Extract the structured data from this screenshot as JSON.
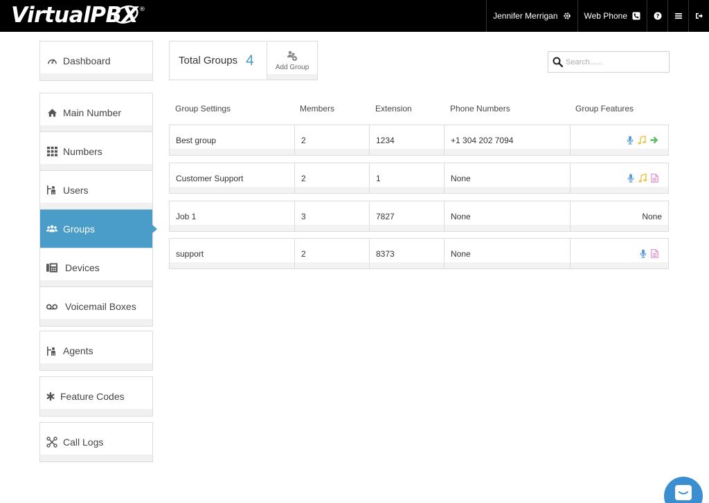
{
  "app": {
    "logo_text_virtual": "Virtual",
    "logo_text_pbx": "PBX",
    "logo_reg": "®"
  },
  "header": {
    "user_name": "Jennifer Merrigan",
    "web_phone_label": "Web Phone",
    "icons": [
      "gear-icon",
      "phone-icon",
      "help-icon",
      "menu-icon",
      "logout-icon"
    ]
  },
  "sidebar": {
    "groups": [
      {
        "items": [
          {
            "label": "Dashboard",
            "icon": "dashboard-icon",
            "active": false
          }
        ]
      },
      {
        "items": [
          {
            "label": "Main Number",
            "icon": "home-icon",
            "active": false
          },
          {
            "label": "Numbers",
            "icon": "grid-icon",
            "active": false
          },
          {
            "label": "Users",
            "icon": "users-icon",
            "active": false
          },
          {
            "label": "Groups",
            "icon": "group-icon",
            "active": true
          },
          {
            "label": "Devices",
            "icon": "fax-icon",
            "active": false
          },
          {
            "label": "Voicemail Boxes",
            "icon": "voicemail-icon",
            "active": false
          }
        ]
      },
      {
        "items": [
          {
            "label": "Agents",
            "icon": "agents-icon",
            "active": false
          }
        ]
      },
      {
        "items": [
          {
            "label": "Feature Codes",
            "icon": "asterisk-icon",
            "active": false
          }
        ]
      },
      {
        "items": [
          {
            "label": "Call Logs",
            "icon": "call-logs-icon",
            "active": false
          }
        ]
      }
    ]
  },
  "summary": {
    "total_label": "Total Groups",
    "total_count": "4",
    "add_group_label": "Add Group"
  },
  "search": {
    "placeholder": "Search......"
  },
  "table": {
    "headers": [
      "Group Settings",
      "Members",
      "Extension",
      "Phone Numbers",
      "Group Features"
    ],
    "rows": [
      {
        "name": "Best group",
        "members": "2",
        "extension": "1234",
        "phone": "+1 304 202 7094",
        "features": [
          "mic-icon",
          "music-icon",
          "forward-arrow-icon"
        ],
        "features_text": ""
      },
      {
        "name": "Customer Support",
        "members": "2",
        "extension": "1",
        "phone": "None",
        "features": [
          "mic-icon",
          "music-icon",
          "document-icon"
        ],
        "features_text": ""
      },
      {
        "name": "Job 1",
        "members": "3",
        "extension": "7827",
        "phone": "None",
        "features": [],
        "features_text": "None"
      },
      {
        "name": "support",
        "members": "2",
        "extension": "8373",
        "phone": "None",
        "features": [
          "mic-icon",
          "document-icon"
        ],
        "features_text": ""
      }
    ]
  },
  "colors": {
    "accent": "#4a9cc9",
    "topbar": "#000000",
    "mic": "#5b9fd6",
    "music": "#f0c34a",
    "forward": "#5cb85c",
    "document": "#e58fcf"
  }
}
